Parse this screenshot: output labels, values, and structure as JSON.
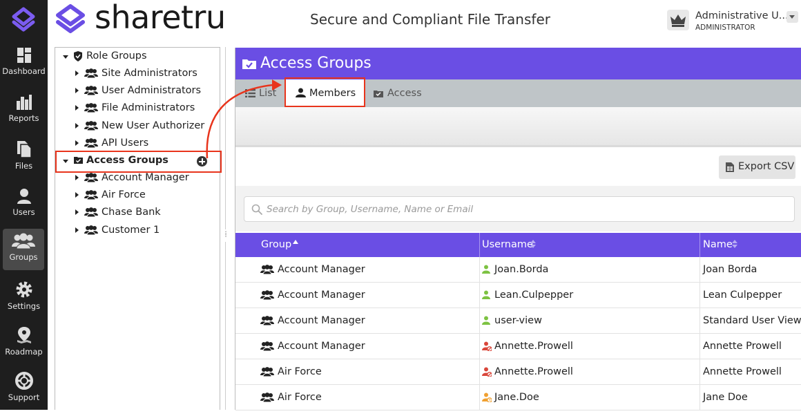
{
  "brand": {
    "name": "sharetru",
    "tagline": "Secure and Compliant File Transfer"
  },
  "user": {
    "name": "Administrative U...",
    "role": "ADMINISTRATOR"
  },
  "nav": [
    {
      "label": "Dashboard",
      "icon": "dashboard-icon",
      "active": false
    },
    {
      "label": "Reports",
      "icon": "reports-icon",
      "active": false
    },
    {
      "label": "Files",
      "icon": "files-icon",
      "active": false
    },
    {
      "label": "Users",
      "icon": "user-icon",
      "active": false
    },
    {
      "label": "Groups",
      "icon": "groups-icon",
      "active": true
    },
    {
      "label": "Settings",
      "icon": "gear-icon",
      "active": false
    },
    {
      "label": "Roadmap",
      "icon": "map-pin-icon",
      "active": false
    },
    {
      "label": "Support",
      "icon": "lifebuoy-icon",
      "active": false
    }
  ],
  "tree": {
    "role_groups": {
      "label": "Role Groups",
      "children": [
        "Site Administrators",
        "User Administrators",
        "File Administrators",
        "New User Authorizer",
        "API Users"
      ]
    },
    "access_groups": {
      "label": "Access Groups",
      "children": [
        "Account Manager",
        "Air Force",
        "Chase Bank",
        "Customer 1"
      ]
    }
  },
  "main": {
    "title": "Access Groups",
    "tabs": [
      {
        "label": "List",
        "icon": "list-icon",
        "active": false
      },
      {
        "label": "Members",
        "icon": "user-icon",
        "active": true
      },
      {
        "label": "Access",
        "icon": "folder-check-icon",
        "active": false
      }
    ],
    "export_label": "Export CSV",
    "search_placeholder": "Search by Group, Username, Name or Email",
    "columns": [
      "Group",
      "Username",
      "Name"
    ],
    "sort": {
      "column": "Group",
      "direction": "ascending"
    },
    "rows": [
      {
        "group": "Account Manager",
        "username": "Joan.Borda",
        "name": "Joan Borda",
        "status": "active"
      },
      {
        "group": "Account Manager",
        "username": "Lean.Culpepper",
        "name": "Lean Culpepper",
        "status": "active"
      },
      {
        "group": "Account Manager",
        "username": "user-view",
        "name": "Standard User View",
        "status": "active"
      },
      {
        "group": "Account Manager",
        "username": "Annette.Prowell",
        "name": "Annette Prowell",
        "status": "disabled"
      },
      {
        "group": "Air Force",
        "username": "Annette.Prowell",
        "name": "Annette Prowell",
        "status": "disabled"
      },
      {
        "group": "Air Force",
        "username": "Jane.Doe",
        "name": "Jane Doe",
        "status": "pending"
      }
    ]
  },
  "colors": {
    "accent": "#6a4ee4",
    "sidebar_bg": "#1e1e1e",
    "highlight": "#e8341c",
    "user_active": "#7dc242",
    "user_disabled": "#d9463a",
    "user_pending": "#f0a030"
  }
}
